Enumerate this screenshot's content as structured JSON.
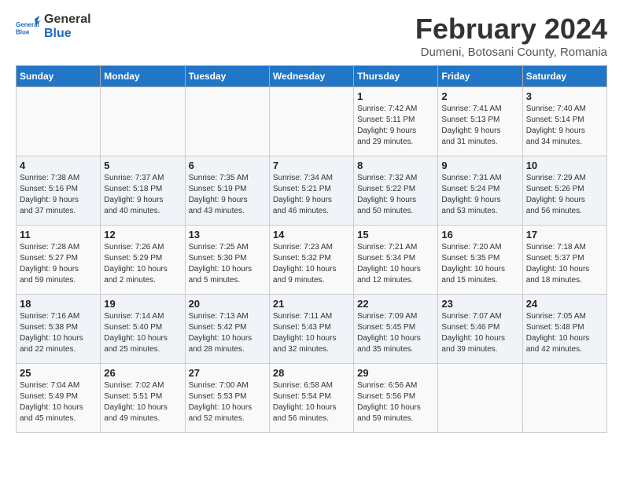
{
  "header": {
    "logo_line1": "General",
    "logo_line2": "Blue",
    "month_year": "February 2024",
    "location": "Dumeni, Botosani County, Romania"
  },
  "columns": [
    "Sunday",
    "Monday",
    "Tuesday",
    "Wednesday",
    "Thursday",
    "Friday",
    "Saturday"
  ],
  "weeks": [
    [
      {
        "day": "",
        "info": ""
      },
      {
        "day": "",
        "info": ""
      },
      {
        "day": "",
        "info": ""
      },
      {
        "day": "",
        "info": ""
      },
      {
        "day": "1",
        "info": "Sunrise: 7:42 AM\nSunset: 5:11 PM\nDaylight: 9 hours\nand 29 minutes."
      },
      {
        "day": "2",
        "info": "Sunrise: 7:41 AM\nSunset: 5:13 PM\nDaylight: 9 hours\nand 31 minutes."
      },
      {
        "day": "3",
        "info": "Sunrise: 7:40 AM\nSunset: 5:14 PM\nDaylight: 9 hours\nand 34 minutes."
      }
    ],
    [
      {
        "day": "4",
        "info": "Sunrise: 7:38 AM\nSunset: 5:16 PM\nDaylight: 9 hours\nand 37 minutes."
      },
      {
        "day": "5",
        "info": "Sunrise: 7:37 AM\nSunset: 5:18 PM\nDaylight: 9 hours\nand 40 minutes."
      },
      {
        "day": "6",
        "info": "Sunrise: 7:35 AM\nSunset: 5:19 PM\nDaylight: 9 hours\nand 43 minutes."
      },
      {
        "day": "7",
        "info": "Sunrise: 7:34 AM\nSunset: 5:21 PM\nDaylight: 9 hours\nand 46 minutes."
      },
      {
        "day": "8",
        "info": "Sunrise: 7:32 AM\nSunset: 5:22 PM\nDaylight: 9 hours\nand 50 minutes."
      },
      {
        "day": "9",
        "info": "Sunrise: 7:31 AM\nSunset: 5:24 PM\nDaylight: 9 hours\nand 53 minutes."
      },
      {
        "day": "10",
        "info": "Sunrise: 7:29 AM\nSunset: 5:26 PM\nDaylight: 9 hours\nand 56 minutes."
      }
    ],
    [
      {
        "day": "11",
        "info": "Sunrise: 7:28 AM\nSunset: 5:27 PM\nDaylight: 9 hours\nand 59 minutes."
      },
      {
        "day": "12",
        "info": "Sunrise: 7:26 AM\nSunset: 5:29 PM\nDaylight: 10 hours\nand 2 minutes."
      },
      {
        "day": "13",
        "info": "Sunrise: 7:25 AM\nSunset: 5:30 PM\nDaylight: 10 hours\nand 5 minutes."
      },
      {
        "day": "14",
        "info": "Sunrise: 7:23 AM\nSunset: 5:32 PM\nDaylight: 10 hours\nand 9 minutes."
      },
      {
        "day": "15",
        "info": "Sunrise: 7:21 AM\nSunset: 5:34 PM\nDaylight: 10 hours\nand 12 minutes."
      },
      {
        "day": "16",
        "info": "Sunrise: 7:20 AM\nSunset: 5:35 PM\nDaylight: 10 hours\nand 15 minutes."
      },
      {
        "day": "17",
        "info": "Sunrise: 7:18 AM\nSunset: 5:37 PM\nDaylight: 10 hours\nand 18 minutes."
      }
    ],
    [
      {
        "day": "18",
        "info": "Sunrise: 7:16 AM\nSunset: 5:38 PM\nDaylight: 10 hours\nand 22 minutes."
      },
      {
        "day": "19",
        "info": "Sunrise: 7:14 AM\nSunset: 5:40 PM\nDaylight: 10 hours\nand 25 minutes."
      },
      {
        "day": "20",
        "info": "Sunrise: 7:13 AM\nSunset: 5:42 PM\nDaylight: 10 hours\nand 28 minutes."
      },
      {
        "day": "21",
        "info": "Sunrise: 7:11 AM\nSunset: 5:43 PM\nDaylight: 10 hours\nand 32 minutes."
      },
      {
        "day": "22",
        "info": "Sunrise: 7:09 AM\nSunset: 5:45 PM\nDaylight: 10 hours\nand 35 minutes."
      },
      {
        "day": "23",
        "info": "Sunrise: 7:07 AM\nSunset: 5:46 PM\nDaylight: 10 hours\nand 39 minutes."
      },
      {
        "day": "24",
        "info": "Sunrise: 7:05 AM\nSunset: 5:48 PM\nDaylight: 10 hours\nand 42 minutes."
      }
    ],
    [
      {
        "day": "25",
        "info": "Sunrise: 7:04 AM\nSunset: 5:49 PM\nDaylight: 10 hours\nand 45 minutes."
      },
      {
        "day": "26",
        "info": "Sunrise: 7:02 AM\nSunset: 5:51 PM\nDaylight: 10 hours\nand 49 minutes."
      },
      {
        "day": "27",
        "info": "Sunrise: 7:00 AM\nSunset: 5:53 PM\nDaylight: 10 hours\nand 52 minutes."
      },
      {
        "day": "28",
        "info": "Sunrise: 6:58 AM\nSunset: 5:54 PM\nDaylight: 10 hours\nand 56 minutes."
      },
      {
        "day": "29",
        "info": "Sunrise: 6:56 AM\nSunset: 5:56 PM\nDaylight: 10 hours\nand 59 minutes."
      },
      {
        "day": "",
        "info": ""
      },
      {
        "day": "",
        "info": ""
      }
    ]
  ]
}
